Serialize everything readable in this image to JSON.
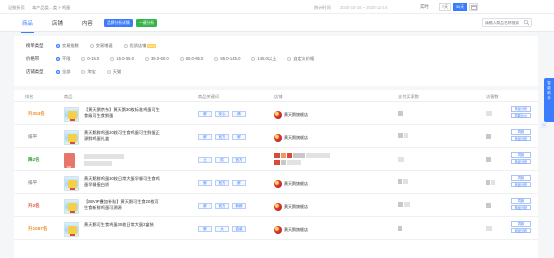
{
  "topbar": {
    "crumbs": [
      "记账折页",
      "本产品类…类 > 鸡蛋"
    ],
    "date_label": "统计时间",
    "date_range": "2020-10-16 ~ 2020-11-14",
    "realtime": "实时",
    "seg_7": "7天",
    "seg_30": "30天"
  },
  "tabs": [
    "商品",
    "店铺",
    "内容"
  ],
  "tab_buttons": [
    "品牌分析详情",
    "一键分析"
  ],
  "search": {
    "placeholder": "请输入商品名称搜索"
  },
  "filters": {
    "row1": {
      "label": "榜单类型",
      "options": [
        "交易指数",
        "交易增速",
        "优质店铺"
      ],
      "new_tag": "NEW"
    },
    "row2": {
      "label": "价格带",
      "options": [
        "不限",
        "0-15.0",
        "15.0-35.0",
        "35.0-60.0",
        "60.0-95.0",
        "95.0-145.0",
        "145.0以上",
        "自定义价格"
      ]
    },
    "row3": {
      "label": "店铺类型",
      "options": [
        "全部",
        "淘宝",
        "天猫"
      ]
    }
  },
  "table": {
    "headers": [
      "排名",
      "商品",
      "商品关键词",
      "店铺",
      "支付买家数",
      "访客数"
    ],
    "rows": [
      {
        "rank": "升253名",
        "rank_color": "orange",
        "title": "【黄天鹅京东】黄天鹅30枚标准鸡蛋可生食级可生食鲜蛋",
        "keywords": [
          "鲜",
          "安心",
          "精"
        ],
        "shop": "黄天鹅旗舰店",
        "actions": [
          "商品分析",
          "同款比价"
        ]
      },
      {
        "rank": "排平",
        "rank_color": "gray",
        "title": "黄天鹅鲜鸡蛋20枚可生食鸡蛋可生鲜蛋正源鲜鸡蛋礼盒",
        "keywords": [
          "鲜",
          "官方",
          "鲜"
        ],
        "shop": "黄天鹅旗舰店",
        "actions": [
          "同款",
          "商品分析"
        ]
      },
      {
        "rank": "降2名",
        "rank_color": "green",
        "title": "",
        "keywords": [
          "土",
          "供",
          "官方"
        ],
        "shop": "",
        "actions": [
          "同款",
          "商品分析"
        ]
      },
      {
        "rank": "排平",
        "rank_color": "gray",
        "title": "黄天鹅鲜鸡蛋30枚日常大蛋早餐可生食鸡蛋早餐蛋白质",
        "keywords": [
          "鲜",
          "官方",
          "鲜"
        ],
        "shop": "黄天鹅旗舰店",
        "actions": [
          "同款",
          "商品分析"
        ]
      },
      {
        "rank": "升2名",
        "rank_color": "red",
        "title": "【88VIP叠加补贴】黄天鹅可生食20枚可生食新鲜鸡蛋可溯源",
        "keywords": [
          "鲜",
          "官方",
          "新鲜"
        ],
        "shop": "黄天鹅旗舰店",
        "actions": [
          "同款",
          "商品分析"
        ]
      },
      {
        "rank": "升1087名",
        "rank_color": "orange",
        "title": "黄天鹅可生食鸡蛋30枚日常大蛋2盒装",
        "keywords": [
          "鲜",
          "大",
          "盒装"
        ],
        "shop": "黄天鹅旗舰店",
        "actions": [
          "同款",
          "商品分析"
        ]
      }
    ]
  },
  "side_float": [
    "智",
    "能",
    "助",
    "手"
  ],
  "colors": {
    "accent": "#3b7cff",
    "green": "#37b34a",
    "orange": "#f08c2c"
  }
}
